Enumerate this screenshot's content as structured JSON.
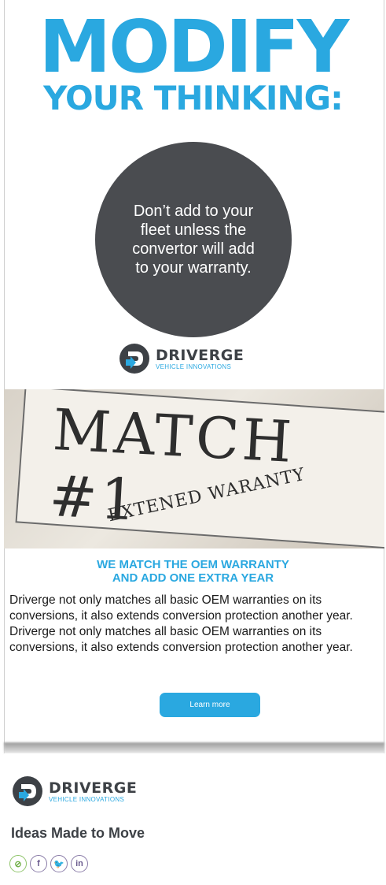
{
  "hero": {
    "line1": "MODIFY",
    "line2": "YOUR THINKING:"
  },
  "circle_text": "Don’t add to your fleet unless the convertor will add to your warranty.",
  "brand": {
    "name": "DRIVERGE",
    "tagline": "VEHICLE INNOVATIONS"
  },
  "photo": {
    "line1": "MATCH #1",
    "line2": "EXTENED WARANTY"
  },
  "headline": {
    "line1": "WE MATCH THE OEM WARRANTY",
    "line2": "AND ADD ONE EXTRA YEAR"
  },
  "body": "Driverge not only matches all basic OEM warranties on its conversions, it also extends conversion protection another year. Driverge not only matches all basic OEM warranties on its conversions, it also extends conversion protection another year.",
  "cta": "Learn more",
  "footer": {
    "slogan": "Ideas Made to Move",
    "socials": [
      {
        "icon": "link-icon",
        "glyph": "⊘"
      },
      {
        "icon": "facebook-icon",
        "glyph": "f"
      },
      {
        "icon": "twitter-icon",
        "glyph": "🐦"
      },
      {
        "icon": "linkedin-icon",
        "glyph": "in"
      }
    ]
  },
  "colors": {
    "accent": "#2aa8e0",
    "dark": "#4a4c50",
    "text": "#1a1a1a"
  }
}
